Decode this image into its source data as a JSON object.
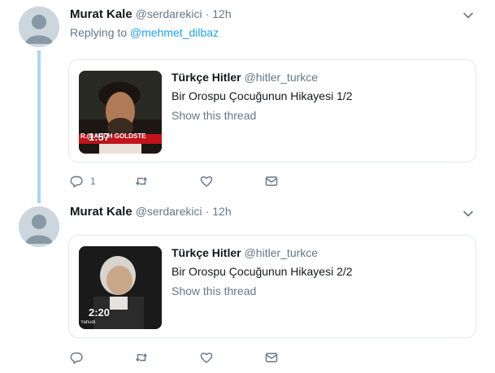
{
  "tweets": [
    {
      "author_name": "Murat Kale",
      "author_handle": "@serdarekici",
      "separator": "·",
      "time": "12h",
      "replying_prefix": "Replying to",
      "replying_mention": "@mehmet_dilbaz",
      "quoted": {
        "name": "Türkçe Hitler",
        "handle": "@hitler_turkce",
        "body": "Bir Orospu Çocuğunun Hikayesi 1/2",
        "show_thread": "Show this thread",
        "video_duration": "1:57",
        "video_caption": "R.(BARUH GOLDSTE"
      },
      "reply_count": "1"
    },
    {
      "author_name": "Murat Kale",
      "author_handle": "@serdarekici",
      "separator": "·",
      "time": "12h",
      "quoted": {
        "name": "Türkçe Hitler",
        "handle": "@hitler_turkce",
        "body": "Bir Orospu Çocuğunun Hikayesi 2/2",
        "show_thread": "Show this thread",
        "video_duration": "2:20",
        "video_caption": "Yahudi"
      },
      "reply_count": ""
    }
  ],
  "colors": {
    "link": "#1da1f2",
    "secondary": "#657786",
    "thread_line": "#a5d7f4",
    "border": "#e1e8ed"
  }
}
